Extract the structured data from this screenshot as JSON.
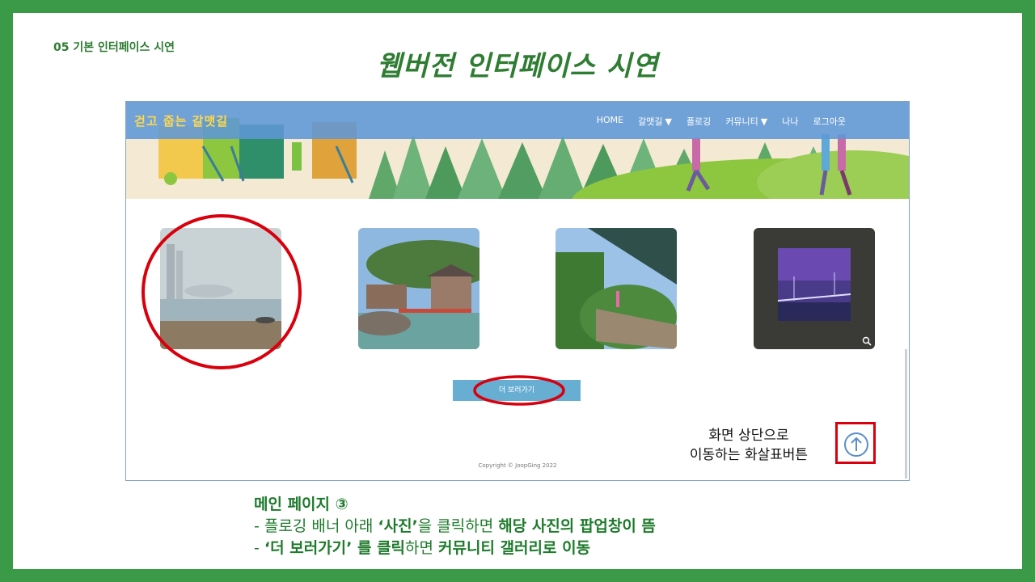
{
  "slide": {
    "section_label": "05 기본 인터페이스 시연",
    "title": "웹버전 인터페이스 시연"
  },
  "site": {
    "logo": "걷고 줍는 갈맷길",
    "nav": [
      {
        "label": "HOME",
        "dropdown": false
      },
      {
        "label": "갈맷길",
        "dropdown": true
      },
      {
        "label": "플로깅",
        "dropdown": false
      },
      {
        "label": "커뮤니티",
        "dropdown": true
      },
      {
        "label": "나나",
        "dropdown": false
      },
      {
        "label": "로그아웃",
        "dropdown": false
      }
    ],
    "photos": [
      {
        "subject": "hazy-beach-photo"
      },
      {
        "subject": "seaside-temple-photo"
      },
      {
        "subject": "stone-wall-walkway-photo"
      },
      {
        "subject": "night-bridge-through-tunnel-photo"
      }
    ],
    "more_button": "더 보러가기",
    "copyright": "Copyright © JoopGing 2022",
    "scroll_top_icon": "arrow-up-circle-icon"
  },
  "annotation": {
    "callout_line1": "화면 상단으로",
    "callout_line2": "이동하는 화살표버튼"
  },
  "description": {
    "heading": "메인 페이지 ③",
    "line1": {
      "prefix": "- 플로깅 배너 아래 ",
      "bold1": "‘사진’",
      "mid": "을 클릭하면 ",
      "bold2": "해당 사진의 팝업창이 뜸"
    },
    "line2": {
      "prefix": "- ",
      "bold1": "‘더 보러가기’  를 클릭",
      "mid": "하면 ",
      "bold2": "커뮤니티 갤러리로 이동"
    }
  },
  "colors": {
    "frame_green": "#3a9a47",
    "title_green": "#2e7d32",
    "nav_blue": "#5e97d7",
    "button_blue": "#68aed3",
    "annotation_red": "#d9000d"
  }
}
